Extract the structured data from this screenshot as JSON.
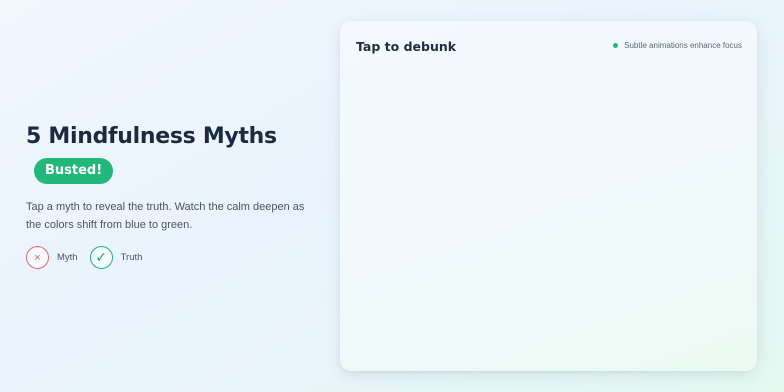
{
  "hero": {
    "title": "5 Mindfulness Myths",
    "badge": "Busted!",
    "description": "Tap a myth to reveal the truth. Watch the calm deepen as the colors shift from blue to green."
  },
  "legend": {
    "myth": {
      "symbol": "×",
      "label": "Myth"
    },
    "truth": {
      "symbol": "✓",
      "label": "Truth"
    }
  },
  "card": {
    "title": "Tap to debunk",
    "hint": "Subtle animations enhance focus"
  },
  "colors": {
    "accent_green": "#22b879",
    "myth_red": "#ef6a6a",
    "title_dark": "#1b2a3e"
  }
}
